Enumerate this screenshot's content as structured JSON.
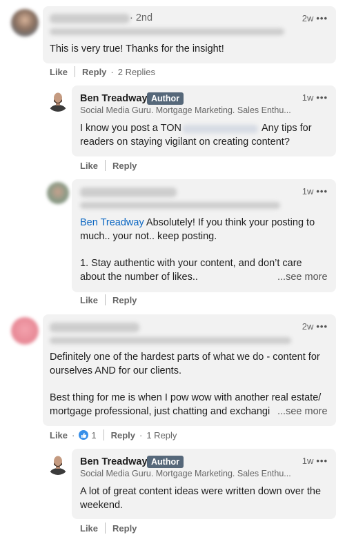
{
  "comments": [
    {
      "degree": "· 2nd",
      "time": "2w",
      "text": "This is very true! Thanks for the insight!",
      "like_label": "Like",
      "reply_label": "Reply",
      "replies_count": "2 Replies"
    },
    {
      "time": "2w",
      "text_line1": "Definitely one of the hardest parts of what we do - content for",
      "text_line2": "ourselves AND for our clients.",
      "text_line3": "Best thing for me is when I pow wow with another real estate/",
      "text_line4": "mortgage professional, just chatting and exchangi",
      "see_more": "...see more",
      "like_label": "Like",
      "reaction_count": "1",
      "reply_label": "Reply",
      "replies_count": "1 Reply"
    }
  ],
  "replies": [
    {
      "name": "Ben Treadway",
      "badge": "Author",
      "subtitle": "Social Media Guru. Mortgage Marketing. Sales Enthu...",
      "time": "1w",
      "text_a": "I know you post a TON",
      "text_b": "Any tips for",
      "text_line2": "readers on staying vigilant on creating content?",
      "like_label": "Like",
      "reply_label": "Reply"
    },
    {
      "time": "1w",
      "mention": "Ben Treadway",
      "text_line1": " Absolutely! If you think your posting to",
      "text_line2": "much.. your not.. keep posting.",
      "text_line3": "1. Stay authentic with your content, and don’t care",
      "text_line4": "about the number of likes..",
      "see_more": "...see more",
      "like_label": "Like",
      "reply_label": "Reply"
    },
    {
      "name": "Ben Treadway",
      "badge": "Author",
      "subtitle": "Social Media Guru. Mortgage Marketing. Sales Enthu...",
      "time": "1w",
      "text_line1": "A lot of great content ideas were written down over the",
      "text_line2": "weekend.",
      "like_label": "Like",
      "reply_label": "Reply"
    }
  ],
  "icons": {
    "more": "more-options-icon",
    "reaction": "like-reaction-icon"
  },
  "colors": {
    "bubble": "#f2f2f2",
    "badge": "#56687a",
    "link": "#0a66c2",
    "reaction": "#378fe9"
  }
}
